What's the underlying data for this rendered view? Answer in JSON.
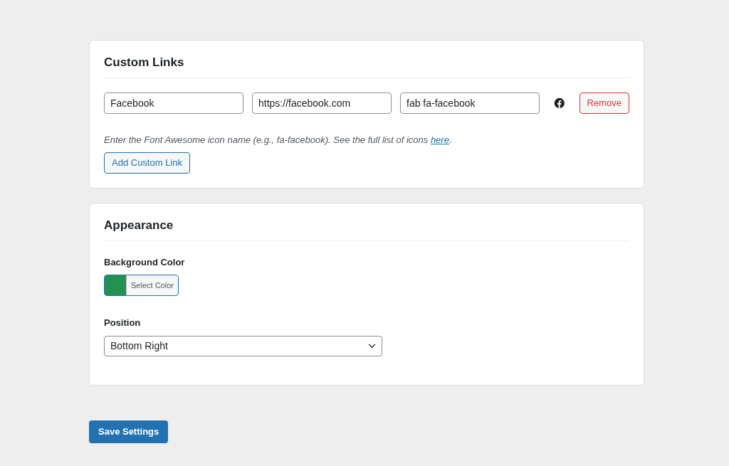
{
  "custom_links": {
    "title": "Custom Links",
    "links": [
      {
        "name": "Facebook",
        "url": "https://facebook.com",
        "icon_class": "fab fa-facebook",
        "remove_label": "Remove"
      }
    ],
    "help_text": {
      "before": "Enter the Font Awesome icon name (e.g., fa-facebook). See the full list of icons",
      "link": "here",
      "after": "."
    },
    "add_button": "Add Custom Link"
  },
  "appearance": {
    "title": "Appearance",
    "background_color": {
      "label": "Background Color",
      "color": "#23914f",
      "button": "Select Color"
    },
    "position": {
      "label": "Position",
      "value": "Bottom Right"
    }
  },
  "save_button": "Save Settings"
}
